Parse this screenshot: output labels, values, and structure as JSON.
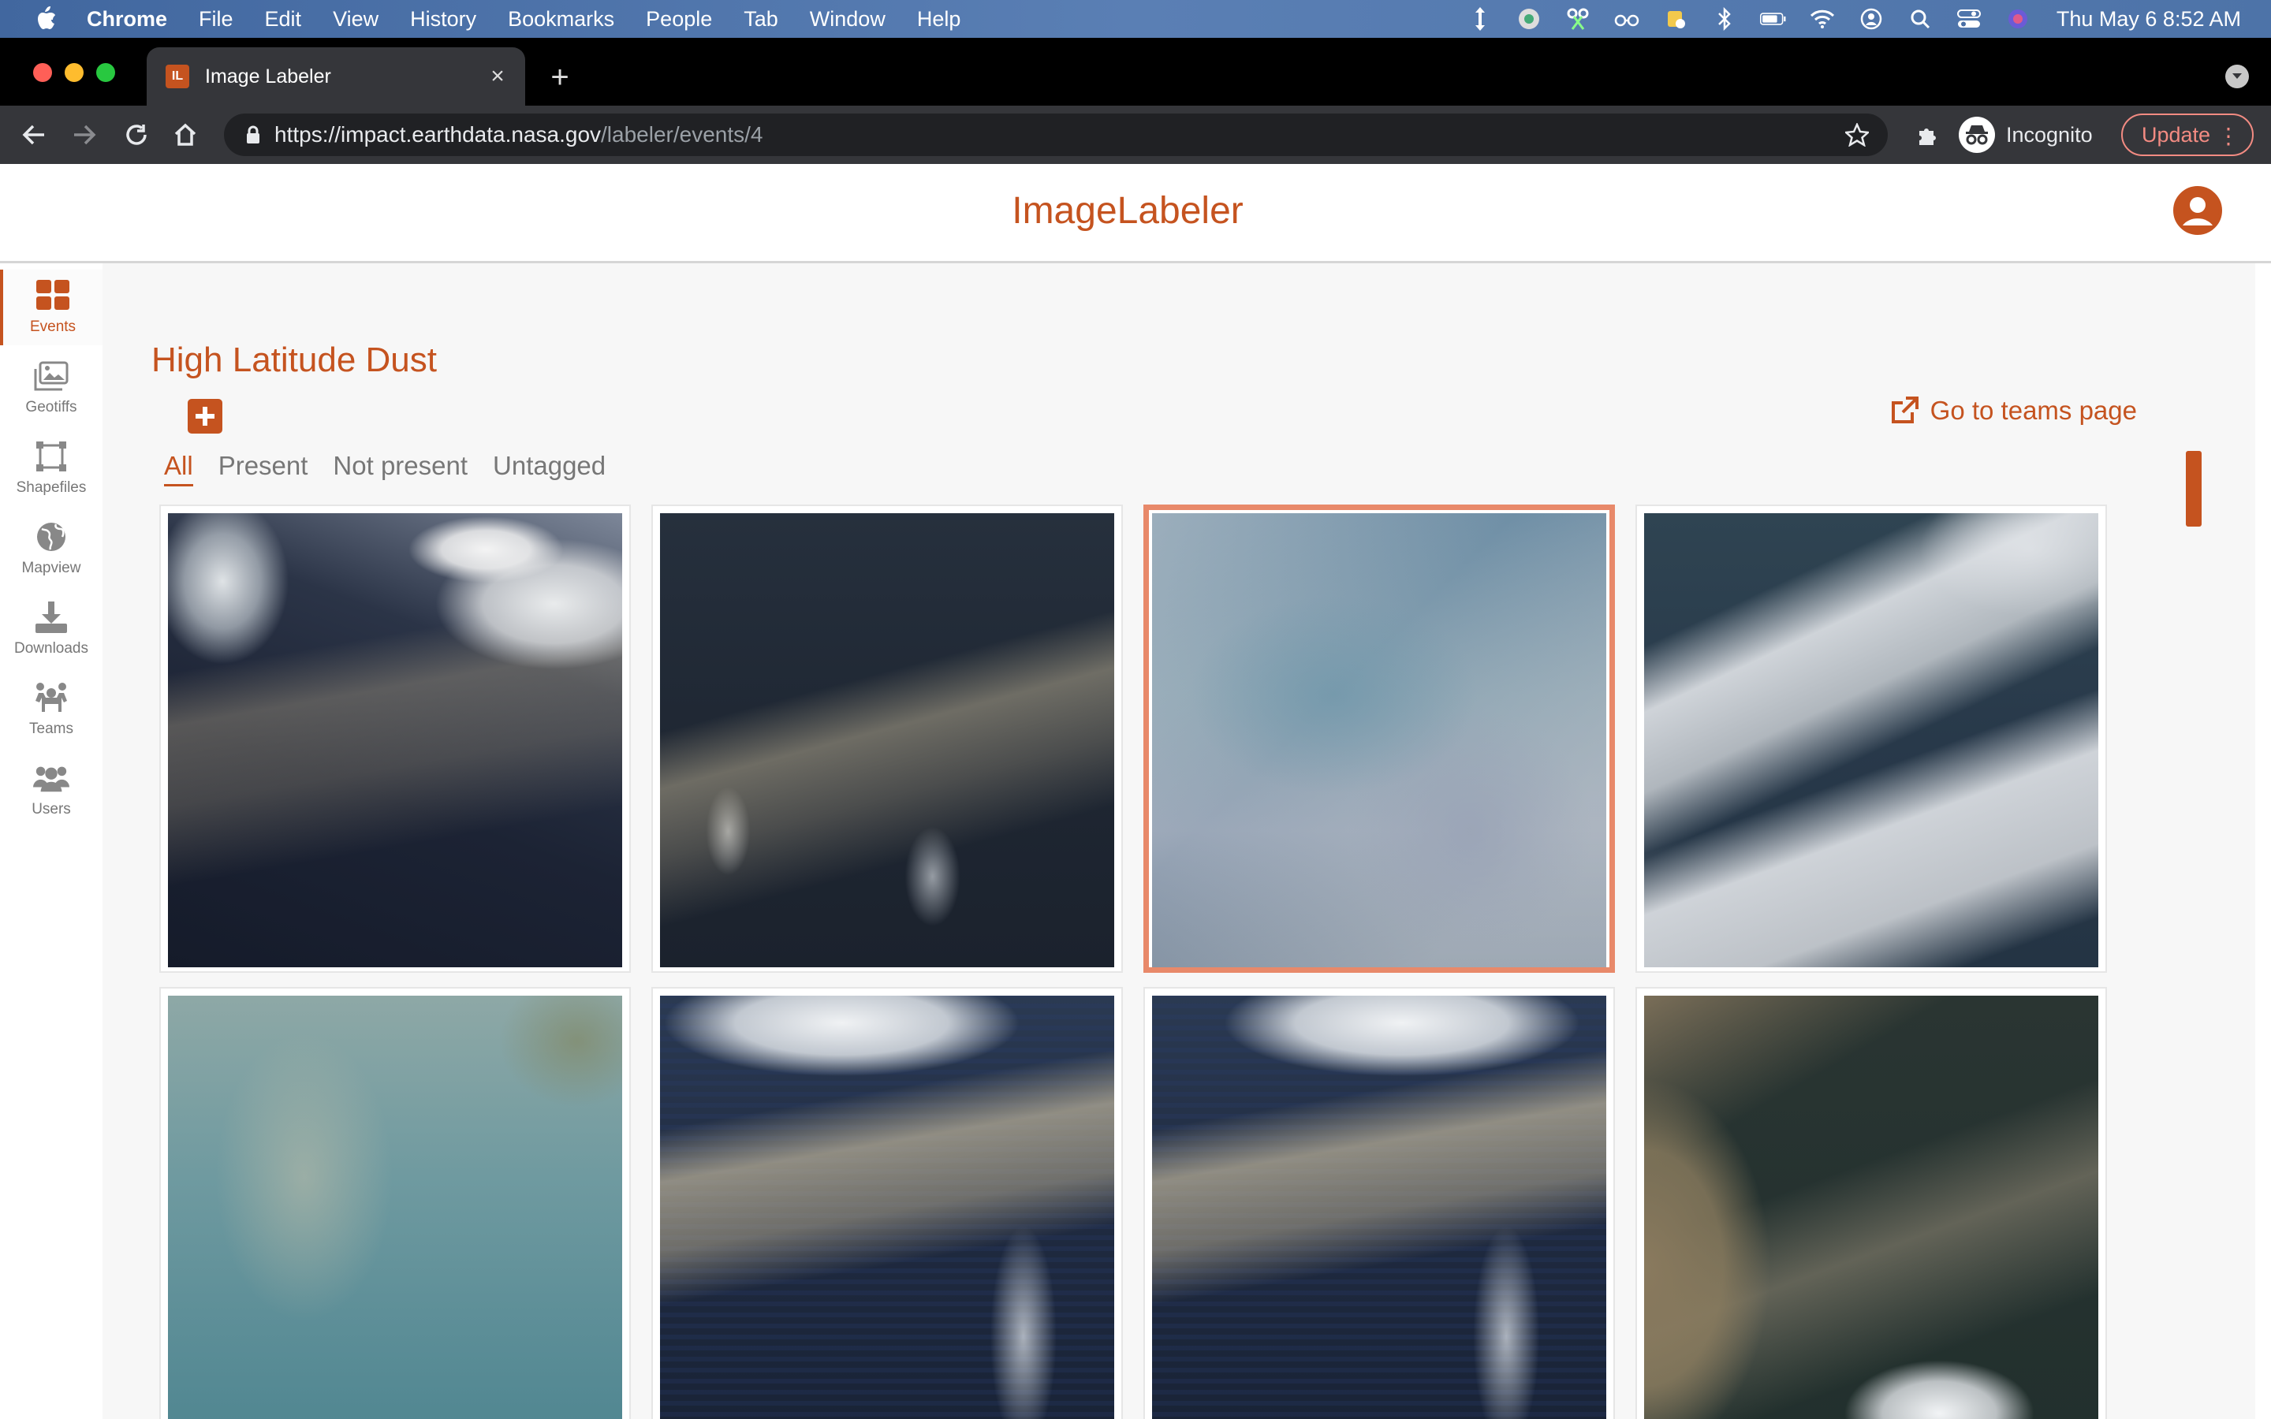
{
  "menubar": {
    "app_name": "Chrome",
    "items": [
      "File",
      "Edit",
      "View",
      "History",
      "Bookmarks",
      "People",
      "Tab",
      "Window",
      "Help"
    ],
    "clock": "Thu May 6  8:52 AM"
  },
  "browser": {
    "tab_title": "Image Labeler",
    "tab_favicon": "IL",
    "url_host": "https://impact.earthdata.nasa.gov",
    "url_path": "/labeler/events/4",
    "profile_label": "Incognito",
    "update_label": "Update"
  },
  "app": {
    "title": "ImageLabeler",
    "accent_color": "#c5531f"
  },
  "sidebar": {
    "items": [
      {
        "label": "Events",
        "icon": "grid-icon",
        "active": true
      },
      {
        "label": "Geotiffs",
        "icon": "images-icon",
        "active": false
      },
      {
        "label": "Shapefiles",
        "icon": "shapes-icon",
        "active": false
      },
      {
        "label": "Mapview",
        "icon": "globe-icon",
        "active": false
      },
      {
        "label": "Downloads",
        "icon": "download-icon",
        "active": false
      },
      {
        "label": "Teams",
        "icon": "team-icon",
        "active": false
      },
      {
        "label": "Users",
        "icon": "users-icon",
        "active": false
      }
    ]
  },
  "event": {
    "title": "High Latitude Dust",
    "teams_link": "Go to teams page",
    "filters": [
      "All",
      "Present",
      "Not present",
      "Untagged"
    ],
    "active_filter": "All",
    "images": [
      {
        "name": "image-1",
        "selected": false
      },
      {
        "name": "image-2",
        "selected": false
      },
      {
        "name": "image-3",
        "selected": true
      },
      {
        "name": "image-4",
        "selected": false
      },
      {
        "name": "image-5",
        "selected": false
      },
      {
        "name": "image-6",
        "selected": false
      },
      {
        "name": "image-7",
        "selected": false
      },
      {
        "name": "image-8",
        "selected": false
      }
    ]
  }
}
